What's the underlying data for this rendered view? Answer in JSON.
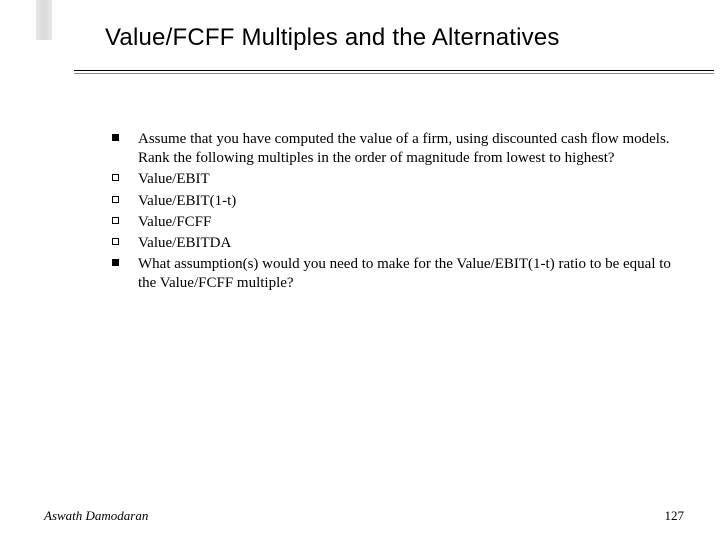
{
  "title": "Value/FCFF Multiples and the Alternatives",
  "items": [
    {
      "marker": "filled",
      "text": "Assume that you have computed the value of a firm, using discounted cash flow models. Rank the following multiples in the order of magnitude from lowest to highest?"
    },
    {
      "marker": "open",
      "text": "Value/EBIT"
    },
    {
      "marker": "open",
      "text": "Value/EBIT(1-t)"
    },
    {
      "marker": "open",
      "text": "Value/FCFF"
    },
    {
      "marker": "open",
      "text": "Value/EBITDA"
    },
    {
      "marker": "filled",
      "text": "What assumption(s) would you need to make for the Value/EBIT(1-t) ratio to be equal to the Value/FCFF multiple?"
    }
  ],
  "footer": {
    "author": "Aswath Damodaran",
    "page": "127"
  }
}
